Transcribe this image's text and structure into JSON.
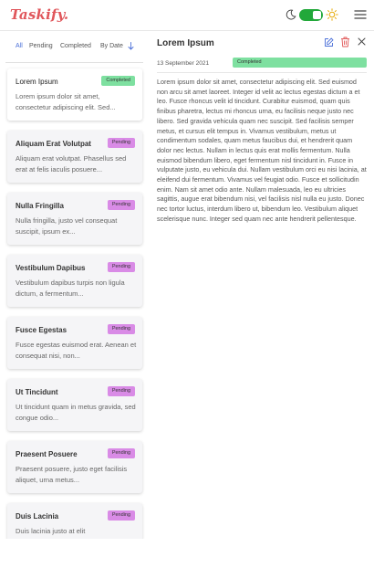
{
  "app": {
    "logo": "Taskify."
  },
  "header": {
    "theme_toggle_on": true,
    "icons": {
      "moon": "moon-icon",
      "sun": "sun-icon",
      "menu": "hamburger-menu-icon"
    },
    "colors": {
      "logo": "#e0565b",
      "toggle": "#22a83a"
    }
  },
  "filters": {
    "all": "All",
    "pending": "Pending",
    "completed": "Completed",
    "sort": "By Date",
    "active": "All"
  },
  "tasks": [
    {
      "title": "Lorem Ipsum",
      "desc": "Lorem ipsum dolor sit amet, consectetur adipiscing elit. Sed...",
      "status": "Completed",
      "selected": true
    },
    {
      "title": "Aliquam Erat Volutpat",
      "desc": "Aliquam erat volutpat. Phasellus sed erat at felis iaculis posuere...",
      "status": "Pending"
    },
    {
      "title": "Nulla Fringilla",
      "desc": "Nulla fringilla, justo vel consequat suscipit, ipsum ex...",
      "status": "Pending"
    },
    {
      "title": "Vestibulum Dapibus",
      "desc": "Vestibulum dapibus turpis non ligula dictum, a fermentum...",
      "status": "Pending"
    },
    {
      "title": "Fusce Egestas",
      "desc": "Fusce egestas euismod erat. Aenean et consequat nisi, non...",
      "status": "Pending"
    },
    {
      "title": "Ut Tincidunt",
      "desc": "Ut tincidunt quam in metus gravida, sed congue odio...",
      "status": "Pending"
    },
    {
      "title": "Praesent Posuere",
      "desc": "Praesent posuere, justo eget facilisis aliquet, urna metus...",
      "status": "Pending"
    },
    {
      "title": "Duis Lacinia",
      "desc": "Duis lacinia justo at elit",
      "status": "Pending"
    }
  ],
  "detail": {
    "title": "Lorem Ipsum",
    "date": "13 September 2021",
    "status": "Completed",
    "body": "Lorem ipsum dolor sit amet, consectetur adipiscing elit. Sed euismod non arcu sit amet laoreet. Integer id velit ac lectus egestas dictum a et leo. Fusce rhoncus velit id tincidunt. Curabitur euismod, quam quis finibus pharetra, lectus mi rhoncus urna, eu facilisis neque justo nec libero. Sed gravida vehicula quam nec suscipit. Sed facilisis semper metus, et cursus elit tempus in. Vivamus vestibulum, metus ut condimentum sodales, quam metus faucibus dui, et hendrerit quam dolor nec lectus. Nullam in lectus quis erat mollis fermentum. Nulla euismod bibendum libero, eget fermentum nisl tincidunt in. Fusce in vulputate justo, eu vehicula dui. Nullam vestibulum orci eu nisi lacinia, at eleifend dui fermentum. Vivamus vel feugiat odio. Fusce et sollicitudin enim. Nam sit amet odio ante. Nullam malesuada, leo eu ultricies sagittis, augue erat bibendum nisi, vel facilisis nisl nulla eu justo. Donec nec tortor luctus, interdum libero ut, bibendum leo. Vestibulum aliquet scelerisque nunc. Integer sed quam nec ante hendrerit pellentesque.",
    "icons": {
      "edit": "edit-icon",
      "delete": "trash-icon",
      "close": "close-icon"
    },
    "colors": {
      "edit": "#4a6fd8",
      "delete": "#e05555",
      "completed_badge": "#7ee0a0",
      "pending_badge": "#d98be6"
    }
  }
}
